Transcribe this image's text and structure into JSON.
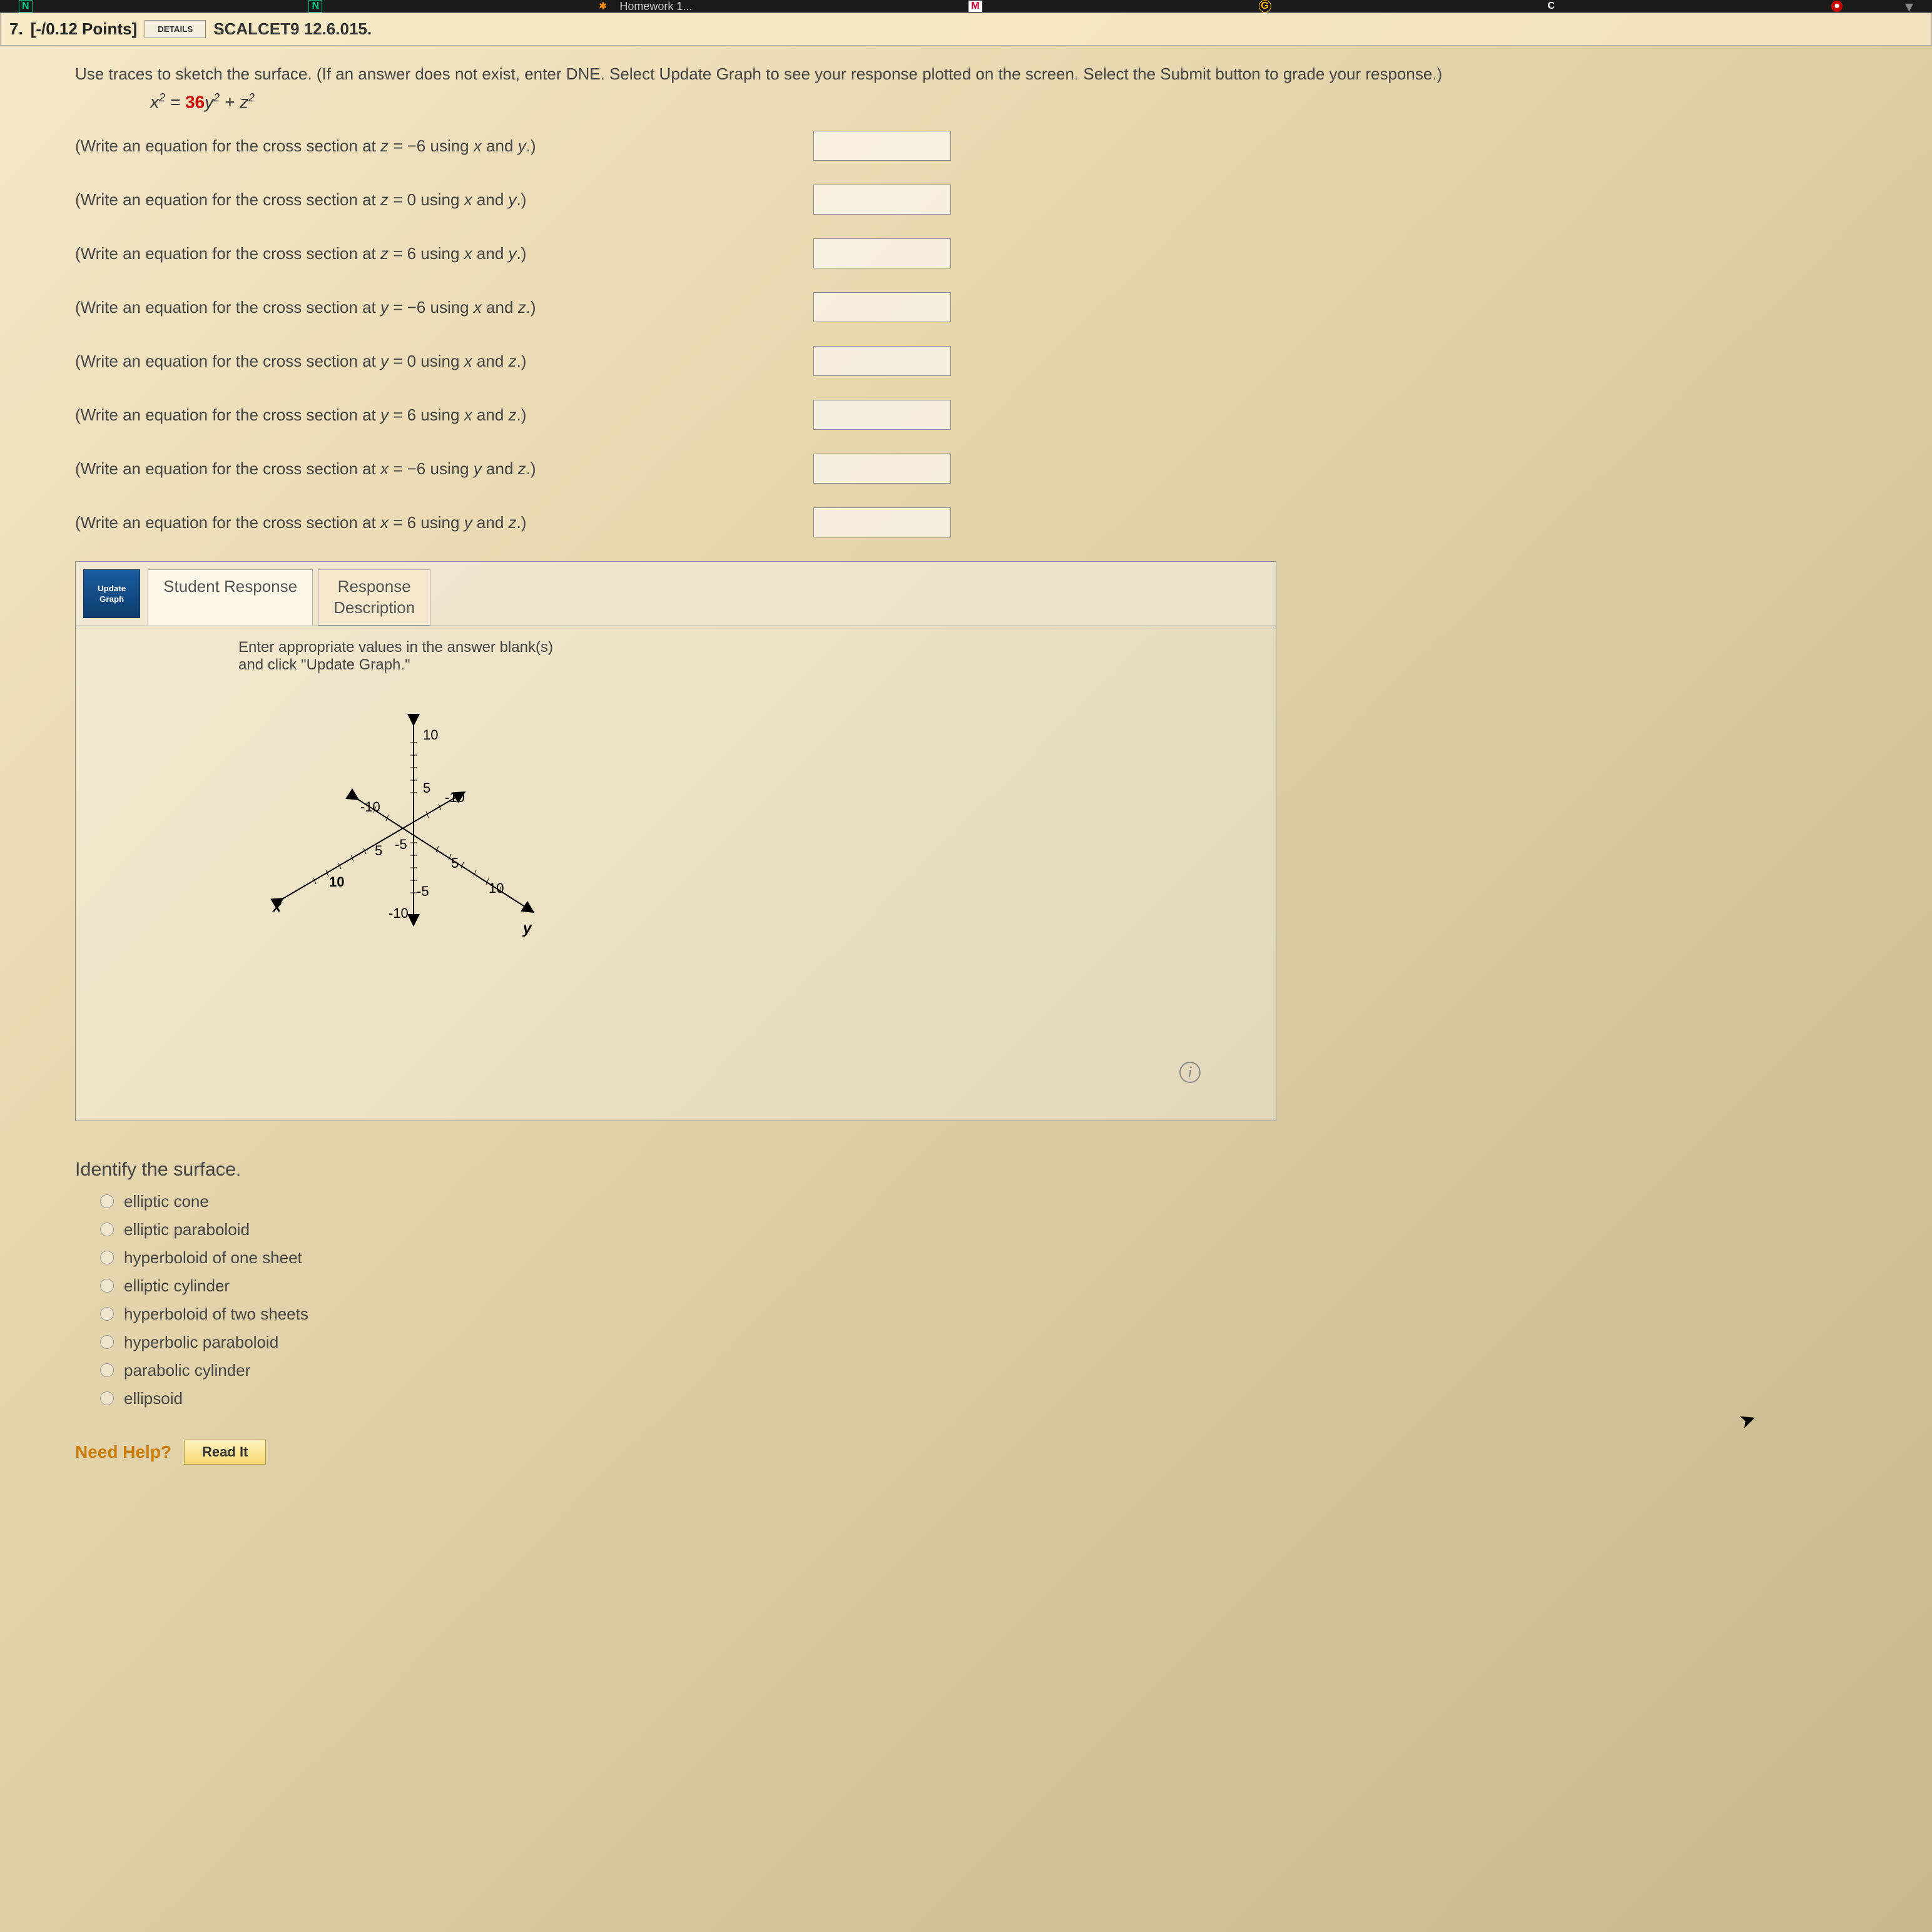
{
  "tabs": {
    "n1": "N",
    "n2": "N",
    "homework": "Homework 1...",
    "m": "M",
    "g": "G",
    "c": "C"
  },
  "question": {
    "number": "7.",
    "points": "[-/0.12 Points]",
    "details": "DETAILS",
    "ref": "SCALCET9 12.6.015."
  },
  "prompt": "Use traces to sketch the surface. (If an answer does not exist, enter DNE. Select Update Graph to see your response plotted on the screen. Select the Submit button to grade your response.)",
  "equation": {
    "lhs": "x",
    "eq": " = ",
    "coef": "36",
    "mid": "y",
    "plus": " + z"
  },
  "rows": [
    {
      "pre": "(Write an equation for the cross section at ",
      "var": "z",
      "val": " = −6 using ",
      "v1": "x",
      "and": " and ",
      "v2": "y",
      "post": ".)"
    },
    {
      "pre": "(Write an equation for the cross section at ",
      "var": "z",
      "val": " = 0 using ",
      "v1": "x",
      "and": " and ",
      "v2": "y",
      "post": ".)"
    },
    {
      "pre": "(Write an equation for the cross section at ",
      "var": "z",
      "val": " = 6 using ",
      "v1": "x",
      "and": " and ",
      "v2": "y",
      "post": ".)"
    },
    {
      "pre": "(Write an equation for the cross section at ",
      "var": "y",
      "val": " = −6 using ",
      "v1": "x",
      "and": " and ",
      "v2": "z",
      "post": ".)"
    },
    {
      "pre": "(Write an equation for the cross section at ",
      "var": "y",
      "val": " = 0 using ",
      "v1": "x",
      "and": " and ",
      "v2": "z",
      "post": ".)"
    },
    {
      "pre": "(Write an equation for the cross section at ",
      "var": "y",
      "val": " = 6 using ",
      "v1": "x",
      "and": " and ",
      "v2": "z",
      "post": ".)"
    },
    {
      "pre": "(Write an equation for the cross section at ",
      "var": "x",
      "val": " = −6 using ",
      "v1": "y",
      "and": " and ",
      "v2": "z",
      "post": ".)"
    },
    {
      "pre": "(Write an equation for the cross section at ",
      "var": "x",
      "val": " = 6 using ",
      "v1": "y",
      "and": " and ",
      "v2": "z",
      "post": ".)"
    }
  ],
  "graph": {
    "update": "Update\nGraph",
    "tab1": "Student Response",
    "tab2": "Response\nDescription",
    "msg": "Enter appropriate values in the answer blank(s)\nand click \"Update Graph.\"",
    "ticks": {
      "p10": "10",
      "p5": "5",
      "m5": "-5",
      "m10": "-10",
      "x": "x",
      "y": "y"
    },
    "info": "i"
  },
  "identify": {
    "title": "Identify the surface.",
    "options": [
      "elliptic cone",
      "elliptic paraboloid",
      "hyperboloid of one sheet",
      "elliptic cylinder",
      "hyperboloid of two sheets",
      "hyperbolic paraboloid",
      "parabolic cylinder",
      "ellipsoid"
    ]
  },
  "help": {
    "label": "Need Help?",
    "read": "Read It"
  }
}
